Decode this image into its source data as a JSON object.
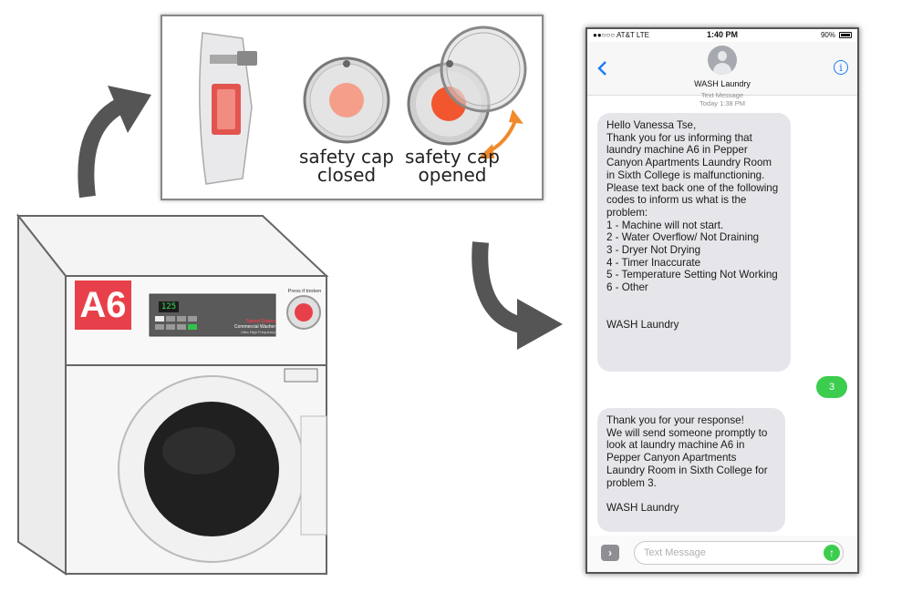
{
  "washer": {
    "machine_label": "A6",
    "display_value": "125",
    "button_label": "Press if broken",
    "brand": "Speed Queen",
    "model_line": "Commercial Washer",
    "sub_line": "Ultra High Frequency"
  },
  "inset": {
    "closed_line1": "safety cap",
    "closed_line2": "closed",
    "opened_line1": "safety cap",
    "opened_line2": "opened"
  },
  "phone": {
    "carrier": "●●○○○ AT&T  LTE",
    "time": "1:40 PM",
    "battery": "90%",
    "contact_name": "WASH Laundry",
    "timestamp_label": "Text Message",
    "timestamp_time": "Today 1:38 PM",
    "messages": [
      {
        "from": "them",
        "text": "Hello Vanessa Tse,\nThank you for us informing that laundry machine A6 in Pepper Canyon Apartments Laundry Room in Sixth College is malfunctioning. Please text back one of the following codes to inform us what is the problem:\n1 - Machine will not start.\n2 - Water Overflow/ Not Draining\n3 - Dryer Not Drying\n4 - Timer Inaccurate\n5 - Temperature Setting Not Working\n6 - Other\n\n\nWASH Laundry"
      },
      {
        "from": "me",
        "text": "3"
      },
      {
        "from": "them",
        "text": "Thank you for your response!\nWe will send someone promptly to look at laundry machine A6 in Pepper Canyon Apartments Laundry Room in Sixth College for problem 3.\n\nWASH Laundry"
      }
    ],
    "input_placeholder": "Text Message"
  },
  "colors": {
    "label_red": "#e8404a",
    "imessage_green": "#3ccd4f",
    "ios_blue": "#1a7cf5",
    "arrow_gray": "#555555"
  },
  "icons": [
    "back-chevron-icon",
    "info-icon",
    "contact-avatar-icon",
    "app-drawer-icon",
    "send-arrow-icon",
    "curved-arrow-icon"
  ]
}
